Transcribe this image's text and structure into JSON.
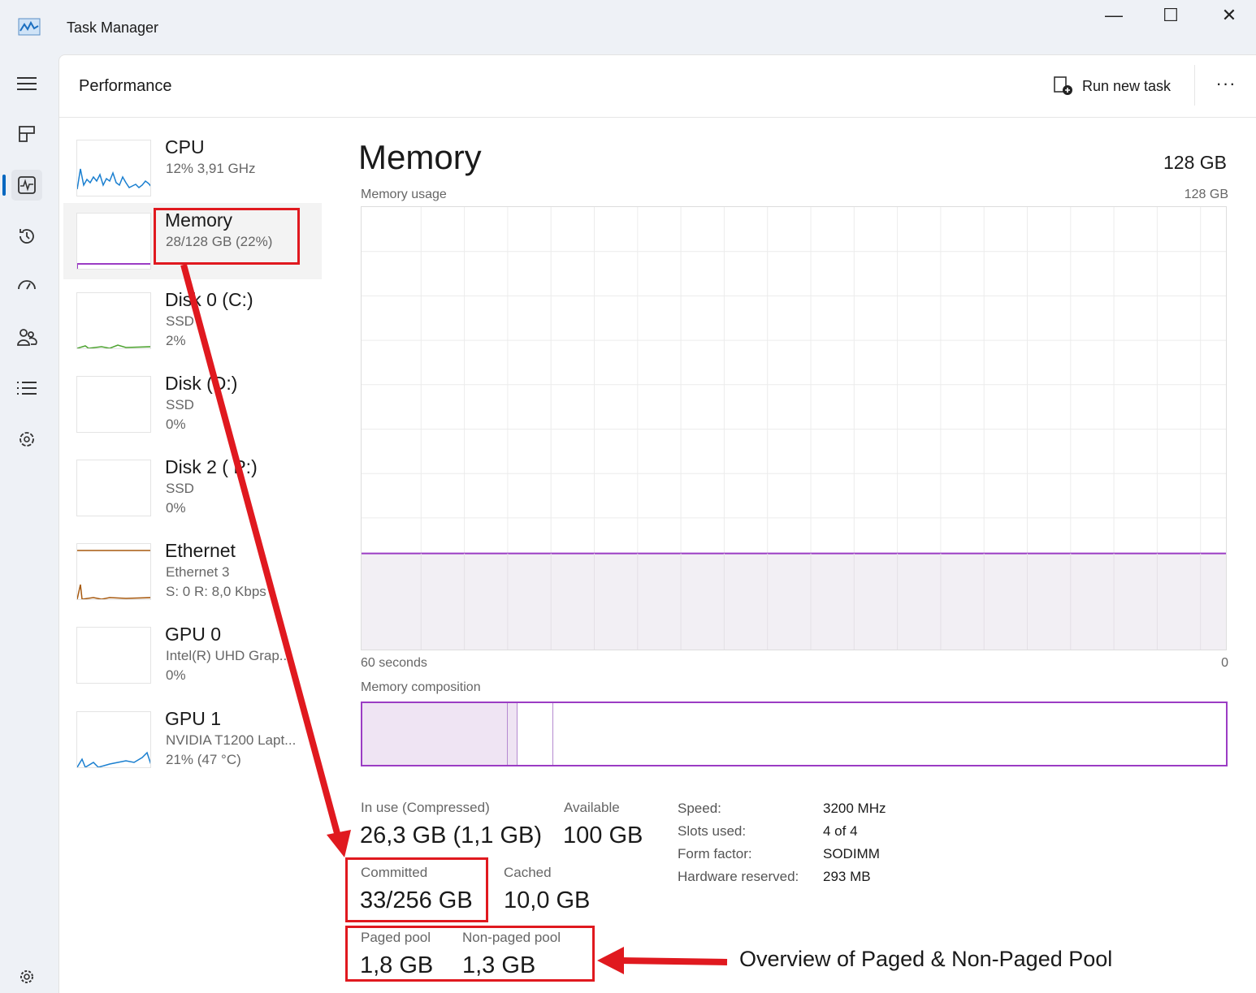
{
  "window": {
    "title": "Task Manager",
    "minimize": "—",
    "maximize": "☐",
    "close": "✕"
  },
  "rail": {
    "items": [
      "menu-icon",
      "processes-icon",
      "performance-icon",
      "app-history-icon",
      "startup-icon",
      "users-icon",
      "details-icon",
      "services-icon",
      "settings-icon"
    ],
    "active": "performance"
  },
  "header": {
    "title": "Performance",
    "run_new_task": "Run new task",
    "more": "···"
  },
  "sidebar": [
    {
      "name": "CPU",
      "lines": [
        "12%  3,91 GHz"
      ],
      "color": "#1a7fd0"
    },
    {
      "name": "Memory",
      "lines": [
        "28/128 GB (22%)"
      ],
      "color": "#9b3cc4"
    },
    {
      "name": "Disk 0 (C:)",
      "lines": [
        "SSD",
        "2%"
      ],
      "color": "#4ca22f"
    },
    {
      "name": "Disk    (D:)",
      "lines": [
        "SSD",
        "0%"
      ],
      "color": "#4ca22f"
    },
    {
      "name": "Disk 2 (   P:)",
      "lines": [
        "SSD",
        "0%"
      ],
      "color": "#4ca22f"
    },
    {
      "name": "Ethernet",
      "lines": [
        "Ethernet 3",
        "S: 0  R: 8,0 Kbps"
      ],
      "color": "#a7590f"
    },
    {
      "name": "GPU 0",
      "lines": [
        "Intel(R) UHD Grap...",
        "0%"
      ],
      "color": "#1a7fd0"
    },
    {
      "name": "GPU 1",
      "lines": [
        "NVIDIA T1200 Lapt...",
        "21%  (47 °C)"
      ],
      "color": "#1a7fd0"
    }
  ],
  "memory": {
    "title": "Memory",
    "total": "128 GB",
    "usage_label": "Memory usage",
    "usage_max": "128 GB",
    "x_left": "60 seconds",
    "x_right": "0",
    "usage_percent": 22,
    "composition_label": "Memory composition",
    "composition": {
      "in_use_gb": 26.3,
      "modified_gb": 1.1,
      "standby_gb": 10.0,
      "total_gb": 128
    },
    "stats": {
      "in_use_label": "In use (Compressed)",
      "in_use": "26,3 GB (1,1 GB)",
      "available_label": "Available",
      "available": "100 GB",
      "committed_label": "Committed",
      "committed": "33/256 GB",
      "cached_label": "Cached",
      "cached": "10,0 GB",
      "paged_label": "Paged pool",
      "paged": "1,8 GB",
      "nonpaged_label": "Non-paged pool",
      "nonpaged": "1,3 GB"
    },
    "specs": [
      {
        "label": "Speed:",
        "value": "3200 MHz"
      },
      {
        "label": "Slots used:",
        "value": "4 of 4"
      },
      {
        "label": "Form factor:",
        "value": "SODIMM"
      },
      {
        "label": "Hardware reserved:",
        "value": "293 MB"
      }
    ]
  },
  "annotation": {
    "text": "Overview of Paged & Non-Paged Pool",
    "color": "#e0191f"
  },
  "accent": "#9b3cc4"
}
